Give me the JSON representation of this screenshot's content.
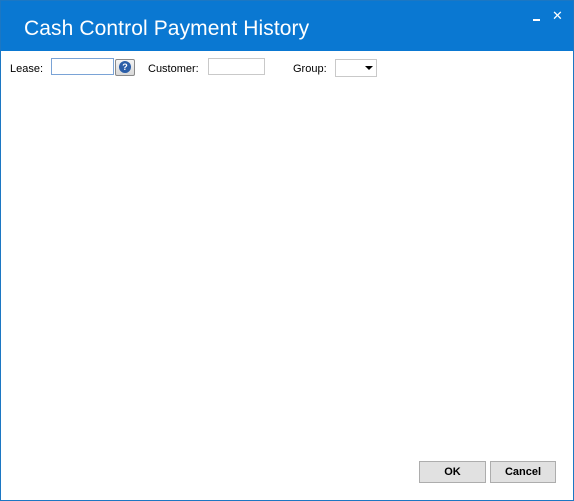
{
  "window": {
    "title": "Cash Control Payment History",
    "minimize_icon": "minimize-icon",
    "close_icon": "close-icon",
    "close_glyph": "✕"
  },
  "filters": {
    "lease_label": "Lease:",
    "lease_value": "",
    "lease_lookup_icon": "question-mark-icon",
    "lease_lookup_glyph": "?",
    "customer_label": "Customer:",
    "customer_value": "",
    "group_label": "Group:",
    "group_value": "",
    "group_arrow_icon": "chevron-down-icon"
  },
  "footer": {
    "ok_label": "OK",
    "cancel_label": "Cancel"
  },
  "colors": {
    "titlebar": "#0a78d2",
    "window_border": "#1c77c3",
    "button_face": "#e1e1e1"
  }
}
